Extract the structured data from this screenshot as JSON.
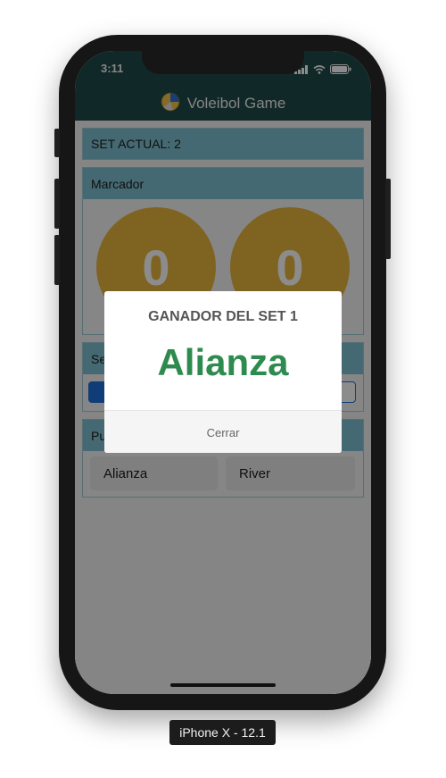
{
  "status_bar": {
    "time": "3:11"
  },
  "nav": {
    "title": "Voleibol Game",
    "logo_icon": "volleyball-icon"
  },
  "set_panel": {
    "label": "SET ACTUAL: 2"
  },
  "scoreboard": {
    "header": "Marcador",
    "scores": [
      {
        "value": "0"
      },
      {
        "value": "0"
      }
    ],
    "circle_color": "#e7b43c"
  },
  "serve_panel": {
    "header_partial": "Se"
  },
  "points_panel": {
    "header_partial": "Pu",
    "teams": [
      {
        "label": "Alianza"
      },
      {
        "label": "River"
      }
    ]
  },
  "modal": {
    "title": "GANADOR DEL SET 1",
    "winner": "Alianza",
    "winner_color": "#2e8b4f",
    "close_label": "Cerrar"
  },
  "device": {
    "label": "iPhone X - 12.1"
  },
  "colors": {
    "nav_bg": "#1e4a48",
    "panel_header": "#7fbfcf",
    "serve_selected": "#1e6fd9"
  }
}
